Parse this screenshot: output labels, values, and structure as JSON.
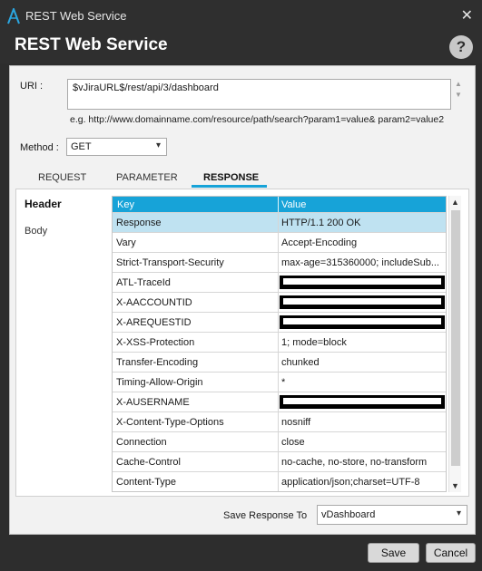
{
  "window": {
    "title": "REST Web Service",
    "dialog_title": "REST Web Service",
    "help_label": "?",
    "close_label": "✕"
  },
  "uri": {
    "label": "URI :",
    "value": "$vJiraURL$/rest/api/3/dashboard",
    "hint": "e.g. http://www.domainname.com/resource/path/search?param1=value& param2=value2"
  },
  "method": {
    "label": "Method :",
    "value": "GET"
  },
  "tabs": [
    {
      "label": "REQUEST"
    },
    {
      "label": "PARAMETER"
    },
    {
      "label": "RESPONSE"
    }
  ],
  "side": {
    "header": "Header",
    "body": "Body"
  },
  "table": {
    "columns": [
      "Key",
      "Value"
    ],
    "rows": [
      {
        "key": "Response",
        "value": "HTTP/1.1 200 OK"
      },
      {
        "key": "Vary",
        "value": "Accept-Encoding"
      },
      {
        "key": "Strict-Transport-Security",
        "value": "max-age=315360000; includeSub..."
      },
      {
        "key": "ATL-TraceId",
        "value": ""
      },
      {
        "key": "X-AACCOUNTID",
        "value": ""
      },
      {
        "key": "X-AREQUESTID",
        "value": ""
      },
      {
        "key": "X-XSS-Protection",
        "value": "1; mode=block"
      },
      {
        "key": "Transfer-Encoding",
        "value": "chunked"
      },
      {
        "key": "Timing-Allow-Origin",
        "value": "*"
      },
      {
        "key": "X-AUSERNAME",
        "value": ""
      },
      {
        "key": "X-Content-Type-Options",
        "value": "nosniff"
      },
      {
        "key": "Connection",
        "value": "close"
      },
      {
        "key": "Cache-Control",
        "value": "no-cache, no-store, no-transform"
      },
      {
        "key": "Content-Type",
        "value": "application/json;charset=UTF-8"
      }
    ]
  },
  "save_response": {
    "label": "Save Response To",
    "value": "vDashboard"
  },
  "buttons": {
    "save": "Save",
    "cancel": "Cancel"
  },
  "colors": {
    "accent": "#17a3d8",
    "selected_row": "#bfe2f1",
    "titlebar": "#2f2f2f"
  }
}
